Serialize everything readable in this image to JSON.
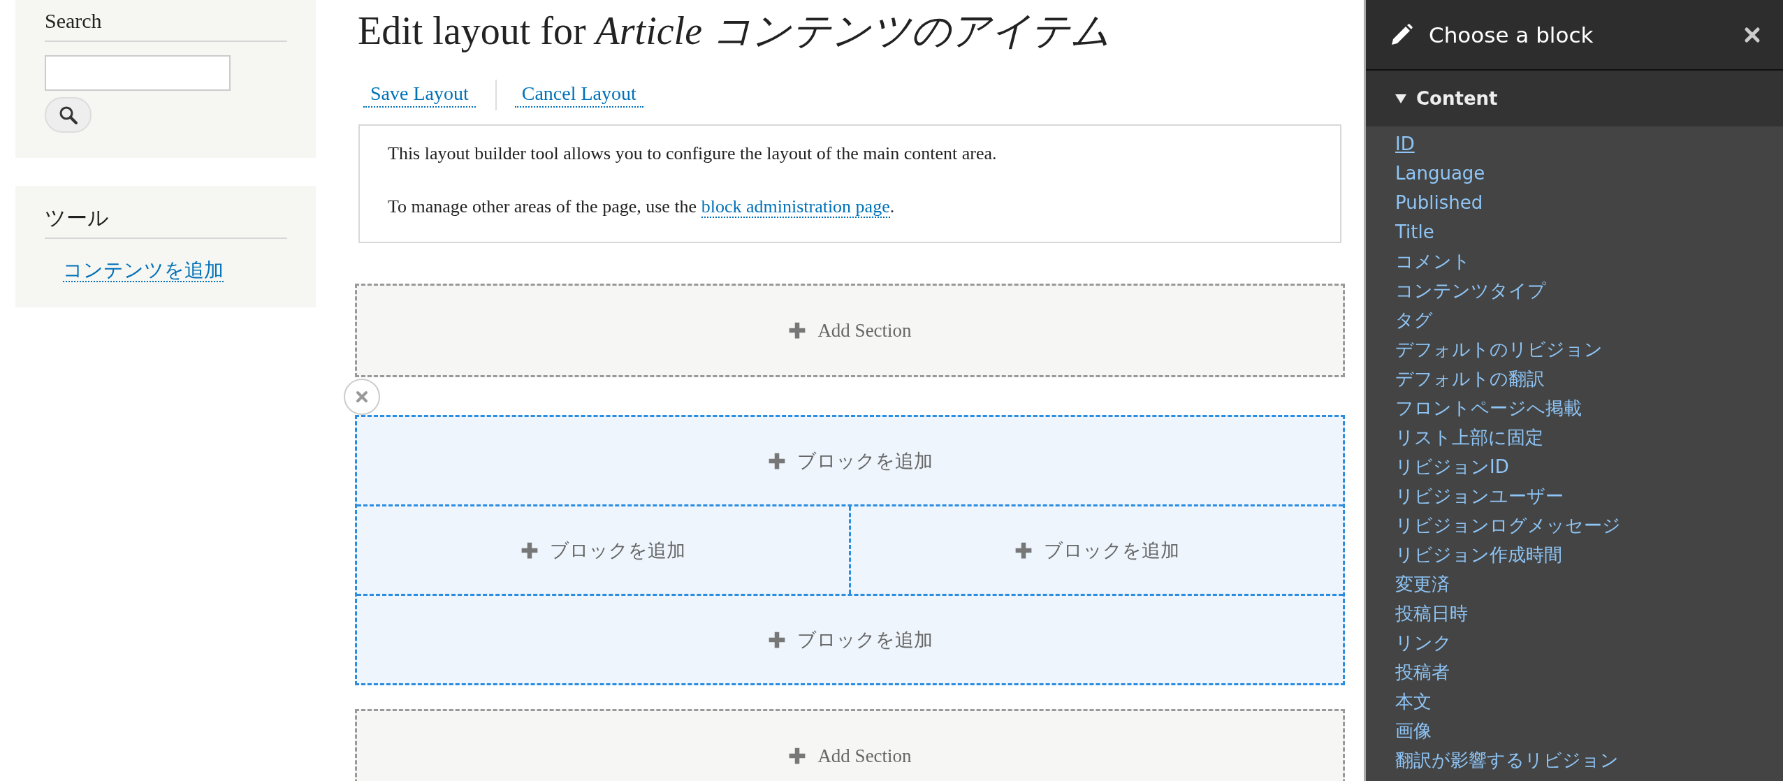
{
  "sidebar": {
    "blocks": [
      {
        "kind": "search",
        "title": "Search"
      },
      {
        "kind": "links",
        "title": "ツール",
        "links": [
          "コンテンツを追加"
        ]
      }
    ]
  },
  "main": {
    "title": "Edit layout for *Article コンテンツのアイテム*",
    "actions": [
      "Save Layout",
      "Cancel Layout"
    ],
    "message": [
      {
        "text": "This layout builder tool allows you to configure the layout of the main content area."
      },
      {
        "text": "To manage other areas of the page, use the ",
        "link": "block administration page",
        "after": "."
      }
    ],
    "sections": [
      {
        "kind": "add_section",
        "label": "Add Section"
      },
      {
        "kind": "layout",
        "rows": [
          [
            "ブロックを追加"
          ],
          [
            "ブロックを追加",
            "ブロックを追加"
          ],
          [
            "ブロックを追加"
          ]
        ]
      },
      {
        "kind": "add_section",
        "label": "Add Section"
      }
    ]
  },
  "panel": {
    "title": "Choose a block",
    "categories": [
      {
        "label": "Content",
        "expanded": true,
        "items": [
          {
            "label": "ID",
            "focused": true
          },
          {
            "label": "Language",
            "focused": false
          },
          {
            "label": "Published",
            "focused": false
          },
          {
            "label": "Title",
            "focused": false
          },
          {
            "label": "コメント",
            "focused": false
          },
          {
            "label": "コンテンツタイプ",
            "focused": false
          },
          {
            "label": "タグ",
            "focused": false
          },
          {
            "label": "デフォルトのリビジョン",
            "focused": false
          },
          {
            "label": "デフォルトの翻訳",
            "focused": false
          },
          {
            "label": "フロントページへ掲載",
            "focused": false
          },
          {
            "label": "リスト上部に固定",
            "focused": false
          },
          {
            "label": "リビジョンID",
            "focused": false
          },
          {
            "label": "リビジョンユーザー",
            "focused": false
          },
          {
            "label": "リビジョンログメッセージ",
            "focused": false
          },
          {
            "label": "リビジョン作成時間",
            "focused": false
          },
          {
            "label": "変更済",
            "focused": false
          },
          {
            "label": "投稿日時",
            "focused": false
          },
          {
            "label": "リンク",
            "focused": false
          },
          {
            "label": "投稿者",
            "focused": false
          },
          {
            "label": "本文",
            "focused": false
          },
          {
            "label": "画像",
            "focused": false
          },
          {
            "label": "翻訳が影響するリビジョン",
            "focused": false
          }
        ]
      }
    ]
  }
}
